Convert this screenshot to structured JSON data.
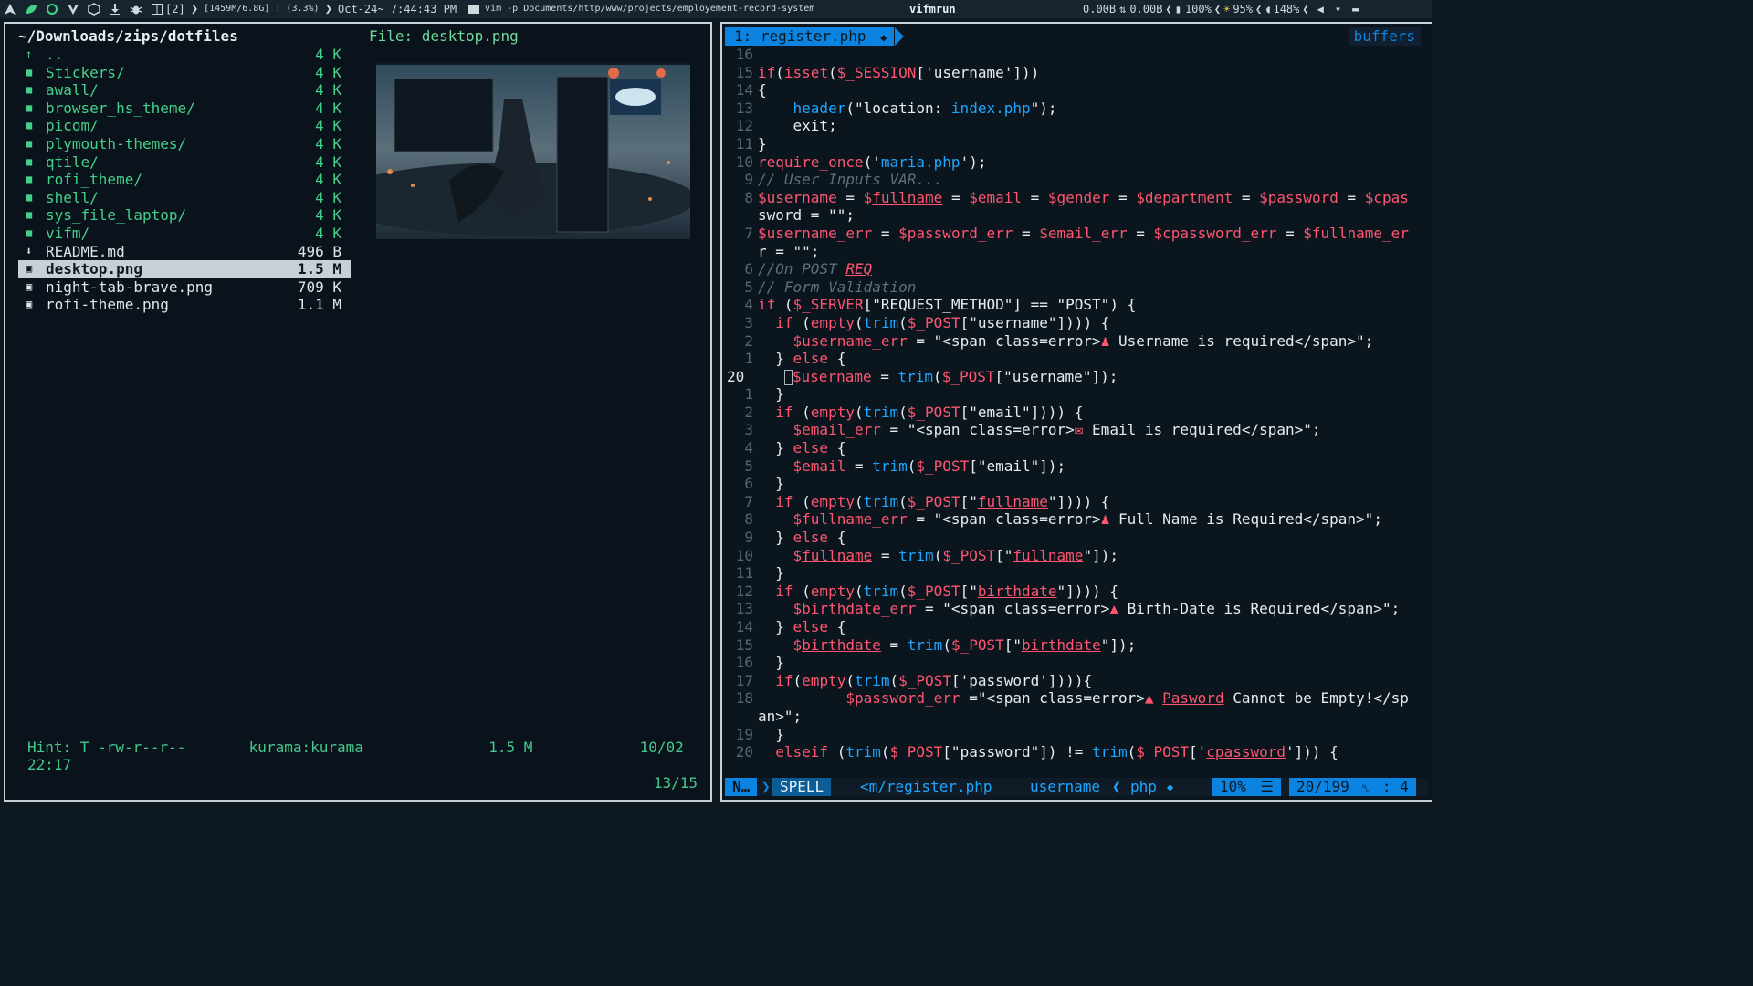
{
  "topbar": {
    "layout_indicator": "[2]",
    "memory": "[1459M/6.8G] : (3.3%)",
    "datetime": "Oct-24~ 7:44:43 PM",
    "window_title": "vim -p Documents/http/www/projects/employement-record-system",
    "center_title": "vifmrun",
    "net_down": "0.00B",
    "net_up": "0.00B",
    "battery": "100%",
    "brightness": "95%",
    "volume": "148%"
  },
  "vifm": {
    "path": "~/Downloads/zips/dotfiles",
    "file_label": "File: desktop.png",
    "entries": [
      {
        "icon": "up-arrow-icon",
        "name": "..",
        "size": "4 K",
        "kind": "dir"
      },
      {
        "icon": "folder-icon",
        "name": "Stickers/",
        "size": "4 K",
        "kind": "dir"
      },
      {
        "icon": "folder-icon",
        "name": "awall/",
        "size": "4 K",
        "kind": "dir"
      },
      {
        "icon": "folder-icon",
        "name": "browser_hs_theme/",
        "size": "4 K",
        "kind": "dir"
      },
      {
        "icon": "folder-icon",
        "name": "picom/",
        "size": "4 K",
        "kind": "dir"
      },
      {
        "icon": "folder-icon",
        "name": "plymouth-themes/",
        "size": "4 K",
        "kind": "dir"
      },
      {
        "icon": "folder-icon",
        "name": "qtile/",
        "size": "4 K",
        "kind": "dir"
      },
      {
        "icon": "folder-icon",
        "name": "rofi_theme/",
        "size": "4 K",
        "kind": "dir"
      },
      {
        "icon": "folder-icon",
        "name": "shell/",
        "size": "4 K",
        "kind": "dir"
      },
      {
        "icon": "folder-icon",
        "name": "sys_file_laptop/",
        "size": "4 K",
        "kind": "dir"
      },
      {
        "icon": "folder-icon",
        "name": "vifm/",
        "size": "4 K",
        "kind": "dir"
      },
      {
        "icon": "download-icon",
        "name": "README.md",
        "size": "496 B",
        "kind": "file"
      },
      {
        "icon": "image-icon",
        "name": "desktop.png",
        "size": "1.5 M",
        "kind": "file",
        "selected": true
      },
      {
        "icon": "image-icon",
        "name": "night-tab-brave.png",
        "size": "709 K",
        "kind": "file"
      },
      {
        "icon": "image-icon",
        "name": "rofi-theme.png",
        "size": "1.1 M",
        "kind": "file"
      }
    ],
    "status": {
      "hint": "Hint: T -rw-r--r--",
      "owner": "kurama:kurama",
      "size": "1.5 M",
      "date": "10/02 22:17",
      "position": "13/15"
    }
  },
  "vim": {
    "tab_label": "1: register.php",
    "buffers_label": "buffers",
    "lines": [
      {
        "n": "16",
        "t": ""
      },
      {
        "n": "15",
        "t": "if(isset($_SESSION['username']))"
      },
      {
        "n": "14",
        "t": "{"
      },
      {
        "n": "13",
        "t": "    header(\"location: index.php\");"
      },
      {
        "n": "12",
        "t": "    exit;"
      },
      {
        "n": "11",
        "t": "}"
      },
      {
        "n": "10",
        "t": "require_once('maria.php');"
      },
      {
        "n": "9",
        "t": "// User Inputs VAR..."
      },
      {
        "n": "8",
        "t": "$username = $fullname = $email = $gender = $department = $password = $cpas"
      },
      {
        "n": "",
        "t": "sword = \"\";"
      },
      {
        "n": "7",
        "t": "$username_err = $password_err = $email_err = $cpassword_err = $fullname_er"
      },
      {
        "n": "",
        "t": "r = \"\";"
      },
      {
        "n": "6",
        "t": "//On POST REQ"
      },
      {
        "n": "5",
        "t": "// Form Validation"
      },
      {
        "n": "4",
        "t": "if ($_SERVER[\"REQUEST_METHOD\"] == \"POST\") {"
      },
      {
        "n": "3",
        "t": "  if (empty(trim($_POST[\"username\"]))) {"
      },
      {
        "n": "2",
        "t": "    $username_err = \"<span class=error>♟ Username is required</span>\";"
      },
      {
        "n": "1",
        "t": "  } else {"
      },
      {
        "n": "20",
        "t": "    $username = trim($_POST[\"username\"]);",
        "current": true
      },
      {
        "n": "1",
        "t": "  }"
      },
      {
        "n": "2",
        "t": "  if (empty(trim($_POST[\"email\"]))) {"
      },
      {
        "n": "3",
        "t": "    $email_err = \"<span class=error>✉ Email is required</span>\";"
      },
      {
        "n": "4",
        "t": "  } else {"
      },
      {
        "n": "5",
        "t": "    $email = trim($_POST[\"email\"]);"
      },
      {
        "n": "6",
        "t": "  }"
      },
      {
        "n": "7",
        "t": "  if (empty(trim($_POST[\"fullname\"]))) {"
      },
      {
        "n": "8",
        "t": "    $fullname_err = \"<span class=error>♟ Full Name is Required</span>\";"
      },
      {
        "n": "9",
        "t": "  } else {"
      },
      {
        "n": "10",
        "t": "    $fullname = trim($_POST[\"fullname\"]);"
      },
      {
        "n": "11",
        "t": "  }"
      },
      {
        "n": "12",
        "t": "  if (empty(trim($_POST[\"birthdate\"]))) {"
      },
      {
        "n": "13",
        "t": "    $birthdate_err = \"<span class=error>▲ Birth-Date is Required</span>\";"
      },
      {
        "n": "14",
        "t": "  } else {"
      },
      {
        "n": "15",
        "t": "    $birthdate = trim($_POST[\"birthdate\"]);"
      },
      {
        "n": "16",
        "t": "  }"
      },
      {
        "n": "17",
        "t": "  if(empty(trim($_POST['password']))){"
      },
      {
        "n": "18",
        "t": "          $password_err =\"<span class=error>▲ Pasword Cannot be Empty!</sp"
      },
      {
        "n": "",
        "t": "an>\";"
      },
      {
        "n": "19",
        "t": "  }"
      },
      {
        "n": "20",
        "t": "  elseif (trim($_POST[\"password\"]) != trim($_POST['cpassword'])) {"
      }
    ],
    "status": {
      "mode": "N…",
      "spell": "SPELL",
      "file": "<m/register.php",
      "tag": "username",
      "filetype": "php",
      "percent": "10%",
      "position": "20/199",
      "col": ":  4"
    }
  },
  "colors": {
    "accent": "#0a84e0",
    "dir_green": "#43d18a",
    "keyword_red": "#ff5570",
    "function_blue": "#1ea7ff"
  }
}
